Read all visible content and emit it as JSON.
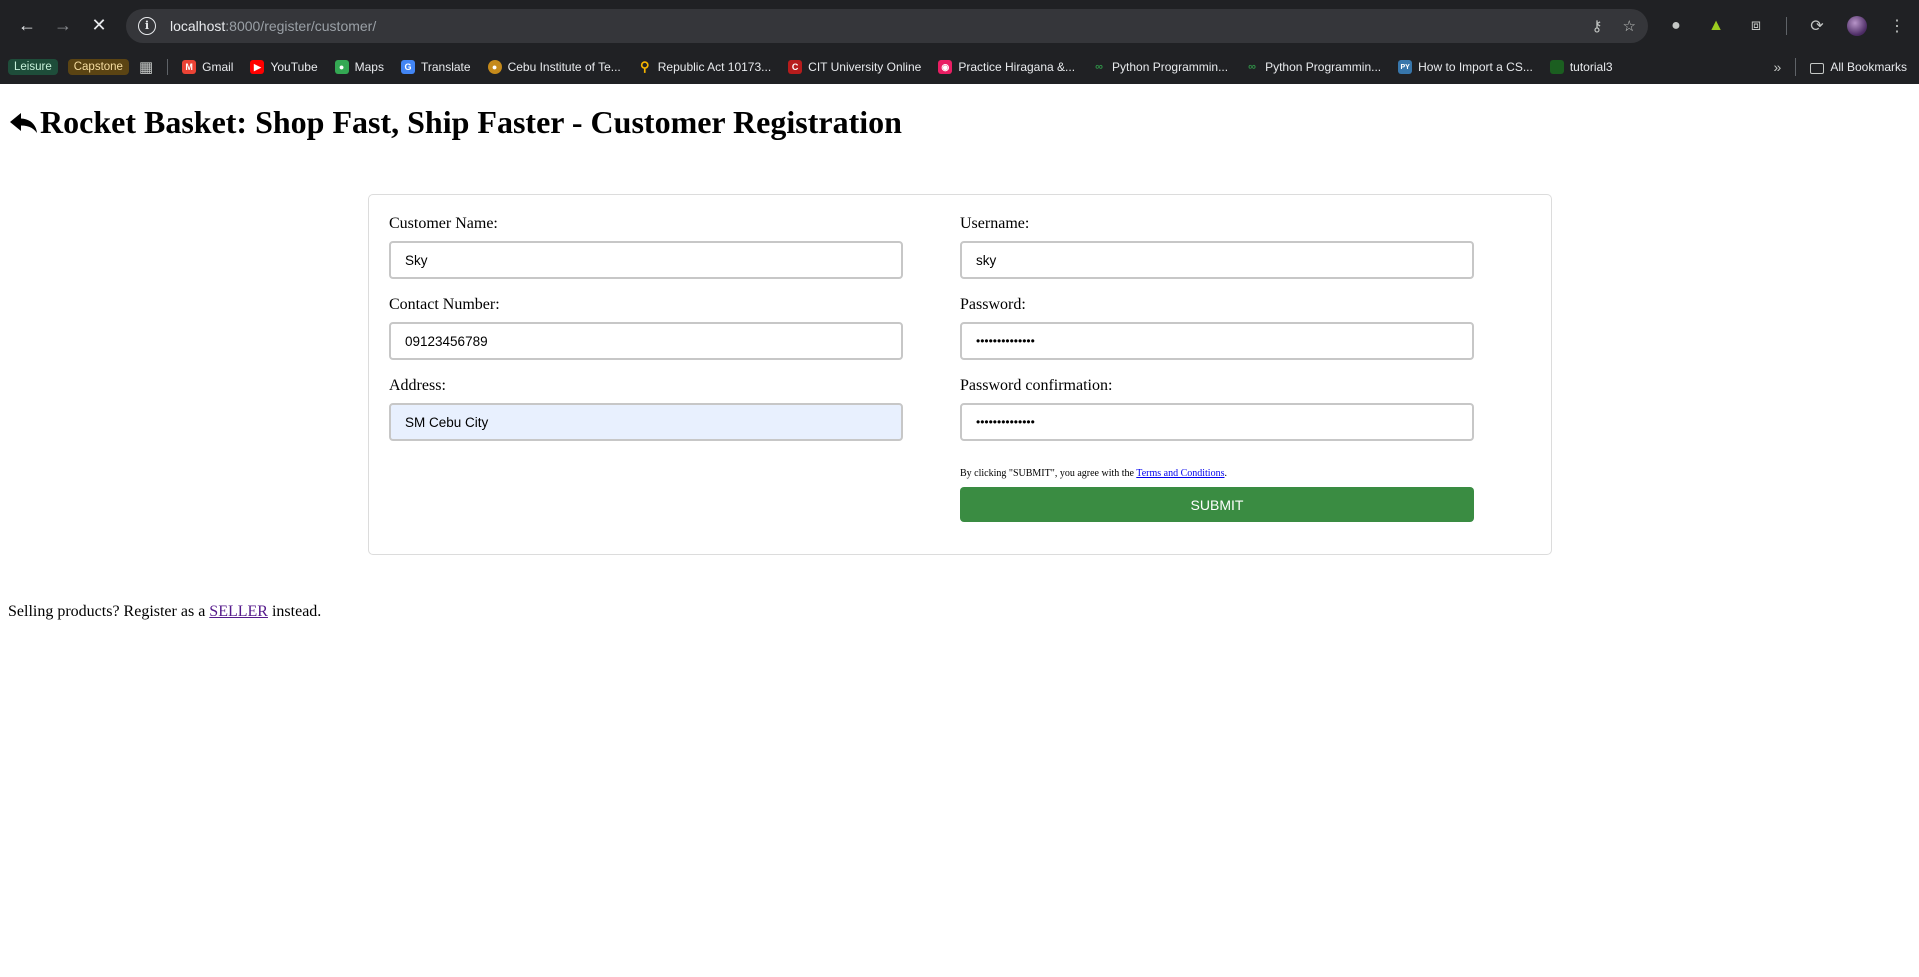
{
  "browser": {
    "url_host": "localhost",
    "url_path": ":8000/register/customer/",
    "bookmarks": {
      "chips": [
        "Leisure",
        "Capstone"
      ],
      "items": [
        {
          "label": "Gmail",
          "icon": "gmail-icon",
          "color": "#ea4335"
        },
        {
          "label": "YouTube",
          "icon": "youtube-icon",
          "color": "#ff0000"
        },
        {
          "label": "Maps",
          "icon": "maps-icon",
          "color": "#34a853"
        },
        {
          "label": "Translate",
          "icon": "translate-icon",
          "color": "#4285f4"
        },
        {
          "label": "Cebu Institute of Te...",
          "icon": "cit-icon",
          "color": "#c58a1b"
        },
        {
          "label": "Republic Act 10173...",
          "icon": "pin-icon",
          "color": "#f4b400"
        },
        {
          "label": "CIT University Online",
          "icon": "cit-online-icon",
          "color": "#b71c1c"
        },
        {
          "label": "Practice Hiragana &...",
          "icon": "hiragana-icon",
          "color": "#e91e63"
        },
        {
          "label": "Python Programmin...",
          "icon": "geeks-icon",
          "color": "#2f8d46"
        },
        {
          "label": "Python Programmin...",
          "icon": "geeks-icon",
          "color": "#2f8d46"
        },
        {
          "label": "How to Import a CS...",
          "icon": "py-icon",
          "color": "#3776ab"
        },
        {
          "label": "tutorial3",
          "icon": "tutorial-icon",
          "color": "#1b5e20"
        }
      ],
      "all_bookmarks": "All Bookmarks"
    }
  },
  "page": {
    "title": "Rocket Basket: Shop Fast, Ship Faster - Customer Registration",
    "form": {
      "customer_name": {
        "label": "Customer Name:",
        "value": "Sky"
      },
      "contact_number": {
        "label": "Contact Number:",
        "value": "09123456789"
      },
      "address": {
        "label": "Address:",
        "value": "SM Cebu City"
      },
      "username": {
        "label": "Username:",
        "value": "sky"
      },
      "password": {
        "label": "Password:",
        "value": "••••••••••••••"
      },
      "password_confirmation": {
        "label": "Password confirmation:",
        "value": "••••••••••••••"
      },
      "terms_prefix": "By clicking \"SUBMIT\", you agree with the ",
      "terms_link": "Terms and Conditions",
      "terms_suffix": ".",
      "submit_label": "SUBMIT"
    },
    "seller_prefix": "Selling products? Register as a ",
    "seller_link": "SELLER",
    "seller_suffix": " instead."
  }
}
